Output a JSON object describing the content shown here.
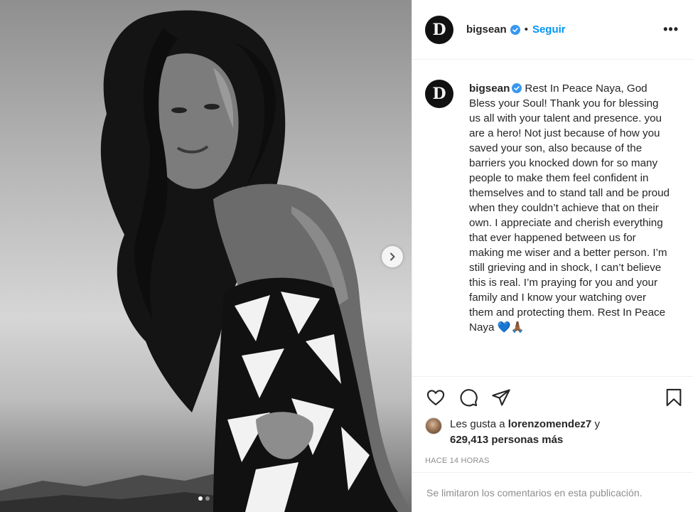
{
  "post": {
    "username": "bigsean",
    "verified": true,
    "separator": "•",
    "follow_label": "Seguir",
    "more_label": "•••",
    "avatar_letter": "D",
    "caption": "Rest In Peace Naya, God Bless your Soul! Thank you for blessing us all with your talent and presence. you are a hero! Not just because of how you saved your son, also because of the barriers you knocked down for so many people to make them feel confident in themselves and to stand tall and be proud when they couldn’t achieve that on their own. I appreciate and cherish everything that ever happened between us for making me wiser and a better person. I’m still grieving and in shock, I can’t believe this is real. I’m praying for you and your family and I know your watching over them and protecting them. Rest In Peace Naya 💙🙏🏾",
    "likes": {
      "prefix": "Les gusta a",
      "liker": "lorenzomendez7",
      "connector": "y",
      "count_text": "629,413 personas más"
    },
    "timestamp": "HACE 14 HORAS",
    "comments_disabled": "Se limitaron los comentarios en esta publicación."
  },
  "carousel": {
    "total": 2,
    "active_index": 0
  },
  "colors": {
    "accent": "#0095f6",
    "text": "#262626",
    "muted": "#8e8e8e",
    "divider": "#efefef"
  },
  "icons": [
    "heart-icon",
    "comment-icon",
    "share-icon",
    "bookmark-icon",
    "chevron-right-icon",
    "verified-badge-icon",
    "more-options-icon"
  ]
}
